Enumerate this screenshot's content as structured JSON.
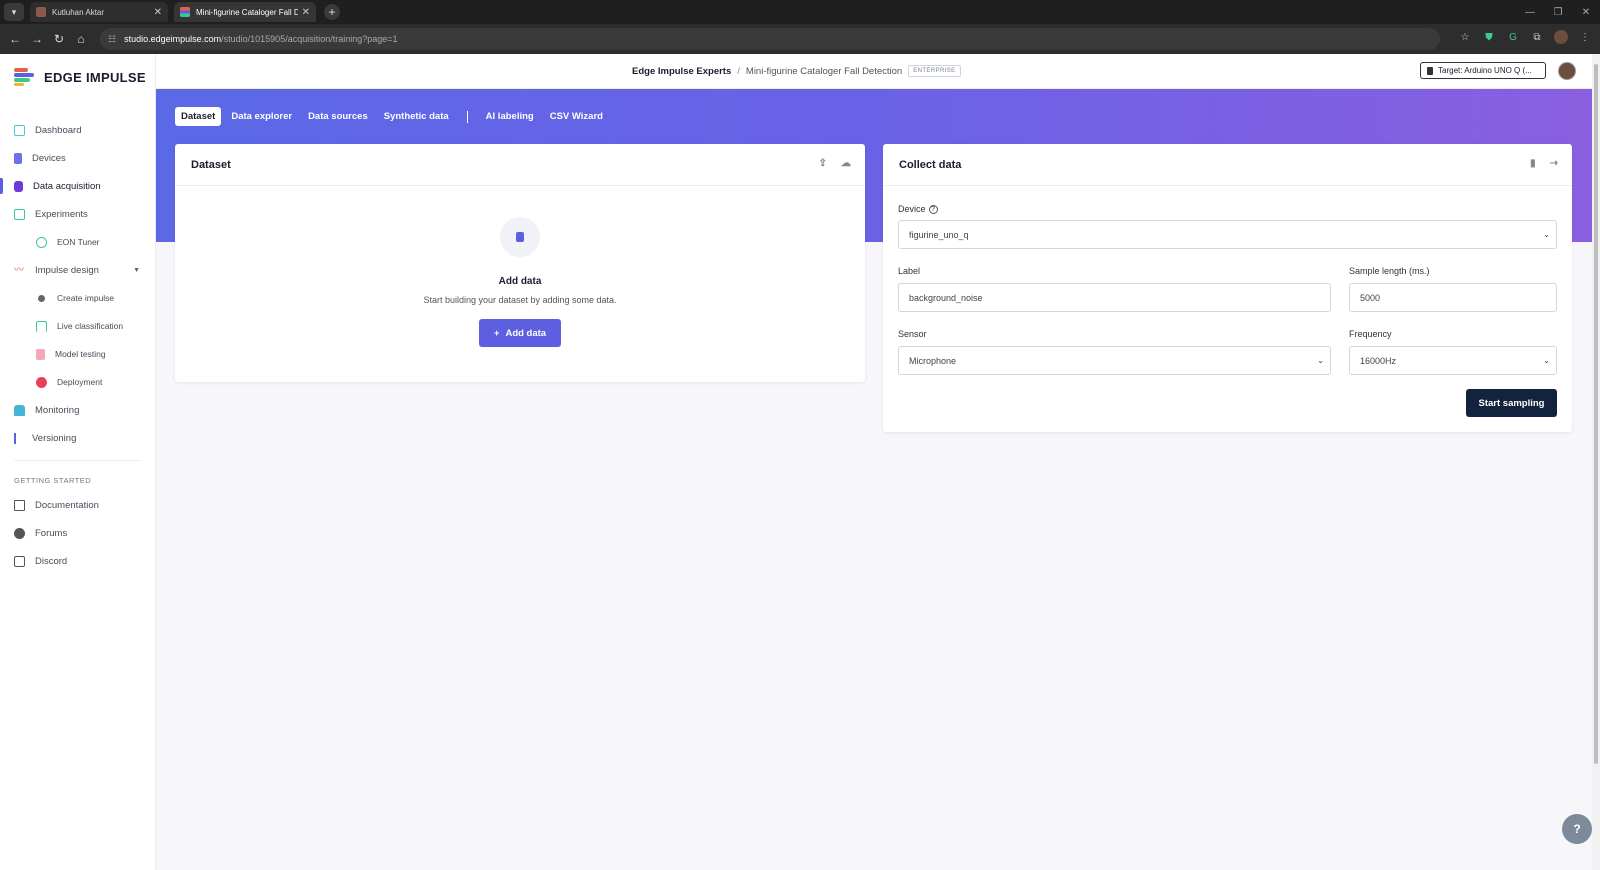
{
  "browser": {
    "tabs": [
      {
        "title": "Kutluhan Aktar",
        "active": false
      },
      {
        "title": "Mini-figurine Cataloger Fall De",
        "active": true
      }
    ],
    "url_host": "studio.edgeimpulse.com",
    "url_path": "/studio/1015905/acquisition/training?page=1"
  },
  "app": {
    "logo_text": "EDGE IMPULSE",
    "accent": "#5b5fe0"
  },
  "sidebar": {
    "items": [
      {
        "label": "Dashboard",
        "icon": "monitor-icon",
        "color": "#43c6d8"
      },
      {
        "label": "Devices",
        "icon": "device-icon",
        "color": "#6b72e8"
      },
      {
        "label": "Data acquisition",
        "icon": "database-icon",
        "color": "#6b3ad8",
        "active": true
      },
      {
        "label": "Experiments",
        "icon": "table-icon",
        "color": "#3ec98c"
      },
      {
        "label": "EON Tuner",
        "icon": "compass-icon",
        "color": "#3ec98c",
        "sub": true
      },
      {
        "label": "Impulse design",
        "icon": "pulse-icon",
        "color": "#e8604c",
        "expandable": true
      },
      {
        "label": "Create impulse",
        "icon": "dot-icon",
        "color": "#666",
        "sub": true
      },
      {
        "label": "Live classification",
        "icon": "flow-icon",
        "color": "#3ec98c",
        "sub": true
      },
      {
        "label": "Model testing",
        "icon": "clipboard-icon",
        "color": "#e86a8a",
        "sub": true
      },
      {
        "label": "Deployment",
        "icon": "box-icon",
        "color": "#e8405c",
        "sub": true
      },
      {
        "label": "Monitoring",
        "icon": "binoculars-icon",
        "color": "#43b6d8"
      },
      {
        "label": "Versioning",
        "icon": "branch-icon",
        "color": "#5b5fe0"
      }
    ],
    "section_label": "GETTING STARTED",
    "resources": [
      {
        "label": "Documentation",
        "icon": "book-icon"
      },
      {
        "label": "Forums",
        "icon": "chat-icon"
      },
      {
        "label": "Discord",
        "icon": "discord-icon"
      }
    ]
  },
  "header": {
    "org": "Edge Impulse Experts",
    "separator": "/",
    "project": "Mini-figurine Cataloger Fall Detection",
    "badge": "ENTERPRISE",
    "target": "Target: Arduino UNO Q (..."
  },
  "tabs": [
    "Dataset",
    "Data explorer",
    "Data sources",
    "Synthetic data",
    "AI labeling",
    "CSV Wizard"
  ],
  "dataset": {
    "title": "Dataset",
    "empty_title": "Add data",
    "empty_subtitle": "Start building your dataset by adding some data.",
    "add_button": "Add data"
  },
  "collect": {
    "title": "Collect data",
    "device_label": "Device",
    "device_value": "figurine_uno_q",
    "label_label": "Label",
    "label_value": "background_noise",
    "sample_length_label": "Sample length (ms.)",
    "sample_length_value": "5000",
    "sensor_label": "Sensor",
    "sensor_value": "Microphone",
    "frequency_label": "Frequency",
    "frequency_value": "16000Hz",
    "start_button": "Start sampling"
  }
}
